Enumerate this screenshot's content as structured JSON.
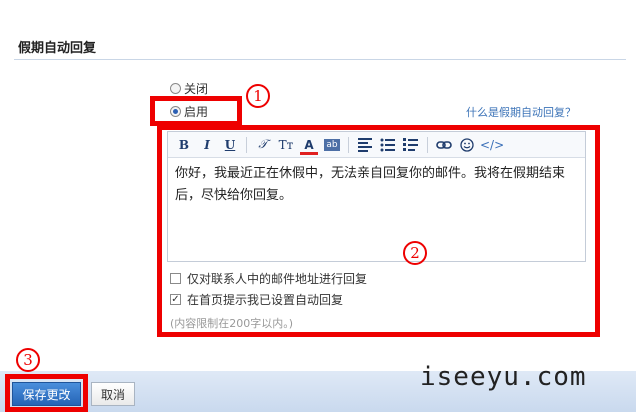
{
  "section": {
    "title": "假期自动回复"
  },
  "options": {
    "off_label": "关闭",
    "on_label": "启用",
    "selected": "启用"
  },
  "help_link": "什么是假期自动回复？",
  "toolbar": {
    "bold": "B",
    "italic": "I",
    "underline": "U",
    "clear_format": "𝒯",
    "font_size": "Tт",
    "font_color": "A",
    "bg_color": "ab",
    "code": "</>",
    "icons": [
      "bold-icon",
      "italic-icon",
      "underline-icon",
      "clear-format-icon",
      "font-size-icon",
      "font-color-icon",
      "highlight-icon",
      "align-icon",
      "bullet-list-icon",
      "numbered-list-icon",
      "link-icon",
      "emoji-icon",
      "source-code-icon"
    ]
  },
  "editor": {
    "content": "你好，我最近正在休假中，无法亲自回复你的邮件。我将在假期结束后，尽快给你回复。"
  },
  "checkboxes": [
    {
      "label": "仅对联系人中的邮件地址进行回复",
      "checked": false
    },
    {
      "label": "在首页提示我已设置自动回复",
      "checked": true
    }
  ],
  "hint": "(内容限制在200字以内。)",
  "buttons": {
    "save": "保存更改",
    "cancel": "取消"
  },
  "annotations": {
    "step1": "1",
    "step2": "2",
    "step3": "3",
    "highlight_color": "#ee0000"
  },
  "watermark": "iseeyu.com"
}
